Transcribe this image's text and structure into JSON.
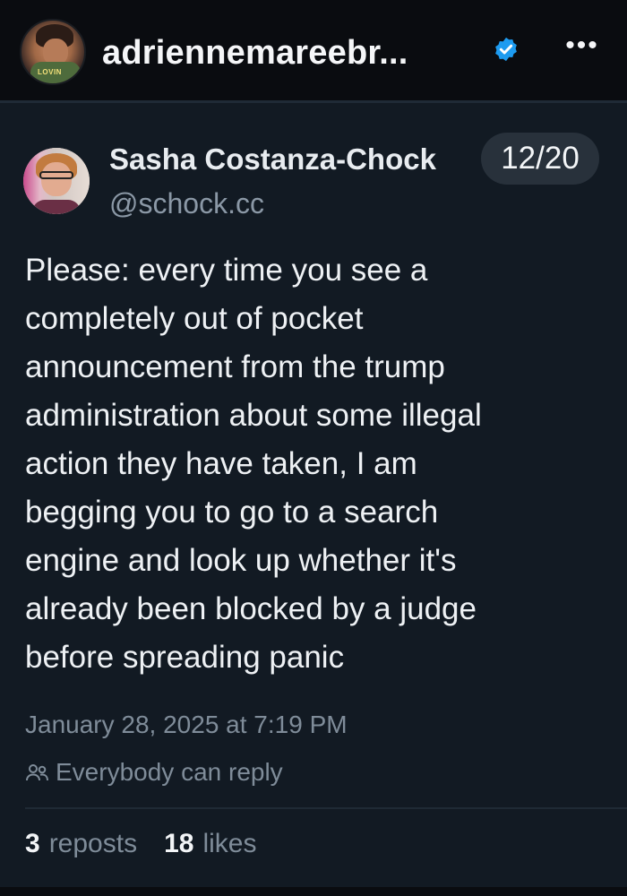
{
  "header": {
    "username": "adriennemareebr...",
    "verified_icon": "verified-badge-icon",
    "verified_color": "#1d9bf0",
    "more_icon": "more-horizontal-icon",
    "avatar_shirt_text": "LOVIN"
  },
  "post": {
    "author_name": "Sasha Costanza-Chock",
    "author_handle": "@schock.cc",
    "thread_counter": "12/20",
    "text": "Please: every time you see a\ncompletely out of pocket\nannouncement from the trump\nadministration about some illegal\naction they have taken, I am\nbegging you to go to a search\nengine and look up whether it's\nalready been blocked by a judge\nbefore spreading panic",
    "timestamp": "January 28, 2025 at 7:19 PM",
    "reply_icon": "people-icon",
    "reply_setting": "Everybody can reply",
    "stats": {
      "reposts_count": "3",
      "reposts_label": "reposts",
      "likes_count": "18",
      "likes_label": "likes"
    }
  },
  "colors": {
    "background": "#0b0e13",
    "card": "#121a23",
    "text_primary": "#eef1f4",
    "text_secondary": "#7f8c99",
    "accent": "#1d9bf0"
  }
}
